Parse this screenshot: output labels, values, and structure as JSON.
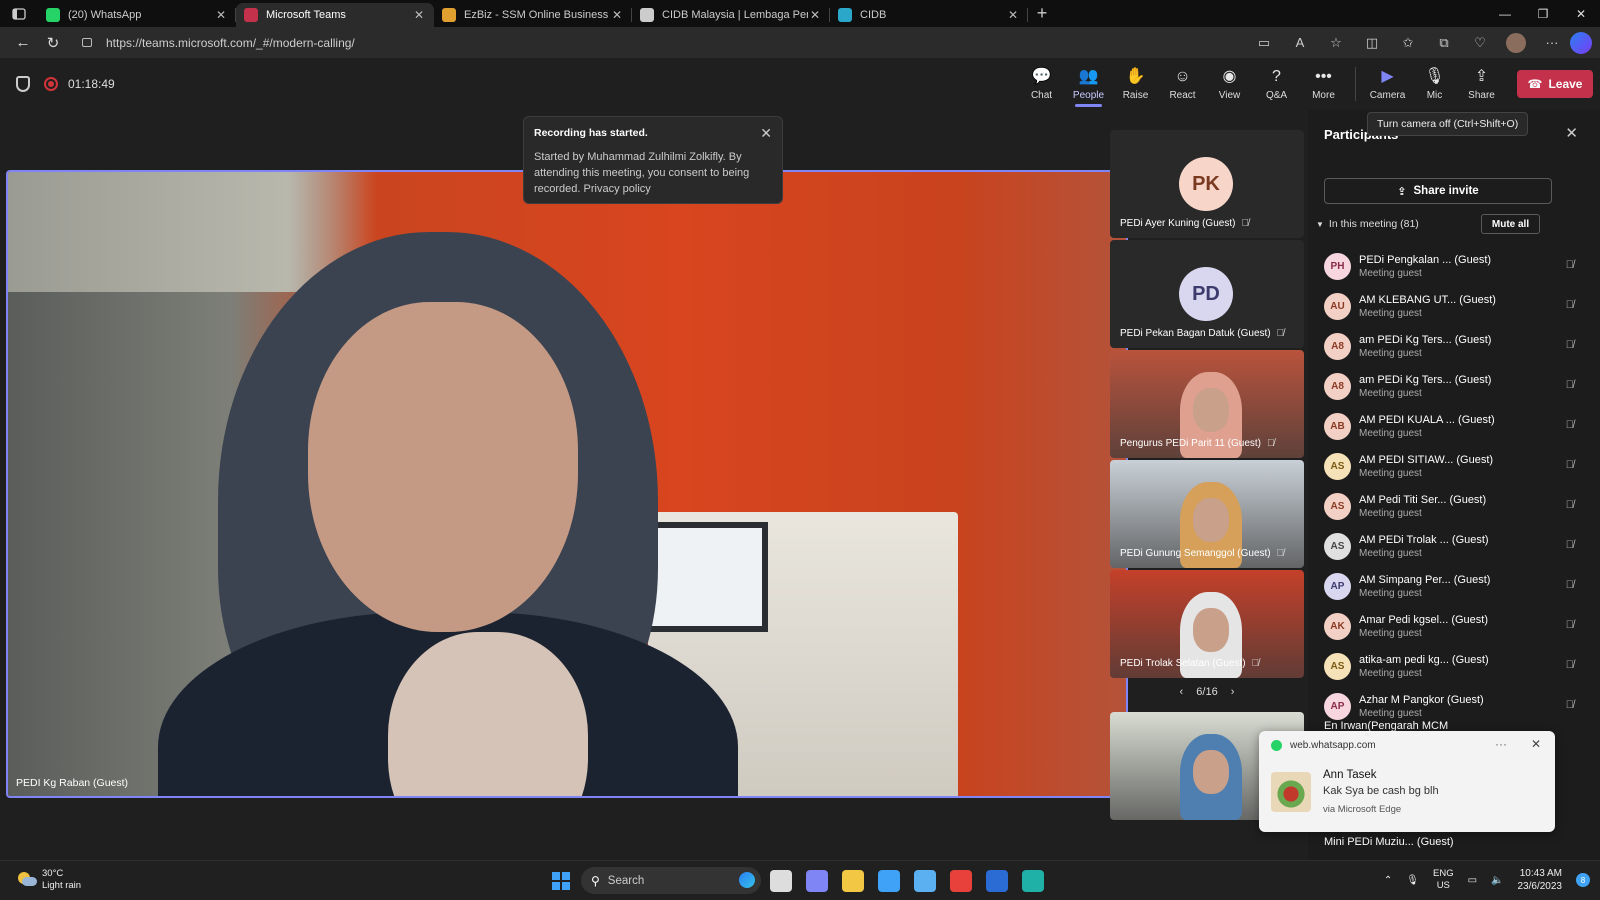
{
  "browser": {
    "tabs": [
      {
        "title": "(20) WhatsApp",
        "color": "#25d366",
        "active": false
      },
      {
        "title": "Microsoft Teams",
        "color": "#c4314b",
        "active": true
      },
      {
        "title": "EzBiz - SSM Online Business Reg",
        "color": "#e0a030",
        "active": false
      },
      {
        "title": "CIDB Malaysia | Lembaga Pemba",
        "color": "#cccccc",
        "active": false
      },
      {
        "title": "CIDB",
        "color": "#2aa7c9",
        "active": false
      }
    ],
    "url": "https://teams.microsoft.com/_#/modern-calling/"
  },
  "call": {
    "timer": "01:18:49",
    "tools": [
      {
        "label": "Chat",
        "icon": "chat-icon",
        "glyph": "💬",
        "active": false
      },
      {
        "label": "People",
        "icon": "people-icon",
        "glyph": "👥",
        "active": true
      },
      {
        "label": "Raise",
        "icon": "hand-icon",
        "glyph": "✋",
        "active": false
      },
      {
        "label": "React",
        "icon": "smile-icon",
        "glyph": "☺",
        "active": false
      },
      {
        "label": "View",
        "icon": "view-icon",
        "glyph": "◉",
        "active": false
      },
      {
        "label": "Q&A",
        "icon": "qa-icon",
        "glyph": "?",
        "active": false
      },
      {
        "label": "More",
        "icon": "more-icon",
        "glyph": "•••",
        "active": false
      }
    ],
    "media": [
      {
        "label": "Camera",
        "icon": "camera-icon",
        "glyph": "▶",
        "color": "#7f85f5"
      },
      {
        "label": "Mic",
        "icon": "mic-off-icon",
        "glyph": "🎙",
        "color": "#e6e6e6"
      },
      {
        "label": "Share",
        "icon": "share-icon",
        "glyph": "⇪",
        "color": "#e6e6e6"
      }
    ],
    "leave_label": "Leave",
    "tooltip": "Turn camera off (Ctrl+Shift+O)"
  },
  "toast": {
    "title": "Recording has started.",
    "body": "Started by Muhammad Zulhilmi Zolkifly. By attending this meeting, you consent to being recorded. Privacy policy"
  },
  "main_video": {
    "name": "PEDI Kg Raban (Guest)"
  },
  "thumbnails": [
    {
      "initials": "PK",
      "name": "PEDi Ayer Kuning (Guest)",
      "type": "avatar",
      "bg": "#f7d6c9",
      "fg": "#7a3a22"
    },
    {
      "initials": "PD",
      "name": "PEDi Pekan Bagan Datuk (Guest)",
      "type": "avatar",
      "bg": "#d9d7f0",
      "fg": "#3d3a6d"
    },
    {
      "initials": "",
      "name": "Pengurus PEDi Parit 11 (Guest)",
      "type": "video",
      "bg": "#b9533c",
      "fg": "#e0a090"
    },
    {
      "initials": "",
      "name": "PEDi Gunung Semanggol (Guest)",
      "type": "video",
      "bg": "#c9d0d7",
      "fg": "#d6a05a"
    },
    {
      "initials": "",
      "name": "PEDi Trolak Selatan (Guest)",
      "type": "video",
      "bg": "#c4402a",
      "fg": "#e5e5e5"
    },
    {
      "initials": "",
      "name": "",
      "type": "video",
      "bg": "#d8dcd2",
      "fg": "#4e7fb0"
    }
  ],
  "pager": "6/16",
  "participants": {
    "title": "Participants",
    "share_invite": "Share invite",
    "in_meeting": "In this meeting (81)",
    "mute_all": "Mute all",
    "list": [
      {
        "initials": "PH",
        "name": "PEDi Pengkalan ... (Guest)",
        "role": "Meeting guest",
        "bg": "#f7d6e0",
        "fg": "#8a2a4a"
      },
      {
        "initials": "AU",
        "name": "AM KLEBANG UT... (Guest)",
        "role": "Meeting guest",
        "bg": "#f3d0c6",
        "fg": "#8a3a22"
      },
      {
        "initials": "A8",
        "name": "am PEDi Kg Ters... (Guest)",
        "role": "Meeting guest",
        "bg": "#f3d0c6",
        "fg": "#8a3a22"
      },
      {
        "initials": "A8",
        "name": "am PEDi Kg Ters... (Guest)",
        "role": "Meeting guest",
        "bg": "#f3d0c6",
        "fg": "#8a3a22"
      },
      {
        "initials": "AB",
        "name": "AM PEDI KUALA ... (Guest)",
        "role": "Meeting guest",
        "bg": "#f3d0c6",
        "fg": "#8a3a22"
      },
      {
        "initials": "AS",
        "name": "AM PEDI SITIAW... (Guest)",
        "role": "Meeting guest",
        "bg": "#f6e2b8",
        "fg": "#7a5a12"
      },
      {
        "initials": "AS",
        "name": "AM Pedi Titi Ser... (Guest)",
        "role": "Meeting guest",
        "bg": "#f3d0c6",
        "fg": "#8a3a22"
      },
      {
        "initials": "AS",
        "name": "AM PEDi Trolak ... (Guest)",
        "role": "Meeting guest",
        "bg": "#e0e0e0",
        "fg": "#444444"
      },
      {
        "initials": "AP",
        "name": "AM Simpang Per... (Guest)",
        "role": "Meeting guest",
        "bg": "#d9d7f0",
        "fg": "#3d3a6d"
      },
      {
        "initials": "AK",
        "name": "Amar Pedi kgsel... (Guest)",
        "role": "Meeting guest",
        "bg": "#f3d0c6",
        "fg": "#8a3a22"
      },
      {
        "initials": "AS",
        "name": "atika-am pedi kg... (Guest)",
        "role": "Meeting guest",
        "bg": "#f6e2b8",
        "fg": "#7a5a12"
      },
      {
        "initials": "AP",
        "name": "Azhar M Pangkor (Guest)",
        "role": "Meeting guest",
        "bg": "#f7d6e0",
        "fg": "#8a2a4a"
      }
    ],
    "partial_top": "En Irwan(Pengarah MCM",
    "partial_bottom": "Mini PEDi Muziu... (Guest)"
  },
  "notification": {
    "source": "web.whatsapp.com",
    "sender": "Ann Tasek",
    "message": "Kak Sya be cash bg blh",
    "via": "via Microsoft Edge"
  },
  "taskbar": {
    "temp": "30°C",
    "weather": "Light rain",
    "search_placeholder": "Search",
    "lang1": "ENG",
    "lang2": "US",
    "time": "10:43 AM",
    "date": "23/6/2023",
    "badge": "8",
    "apps": [
      {
        "name": "taskview-icon",
        "color": "#dddddd"
      },
      {
        "name": "teams-chat-icon",
        "color": "#7f85f5"
      },
      {
        "name": "file-explorer-icon",
        "color": "#f2c744"
      },
      {
        "name": "store-icon",
        "color": "#3fa2f7"
      },
      {
        "name": "settings-app-icon",
        "color": "#5ab0f0"
      },
      {
        "name": "wps-icon",
        "color": "#e8413b"
      },
      {
        "name": "word-icon",
        "color": "#2b6bd4"
      },
      {
        "name": "edge-icon",
        "color": "#1fb1a8"
      }
    ]
  }
}
